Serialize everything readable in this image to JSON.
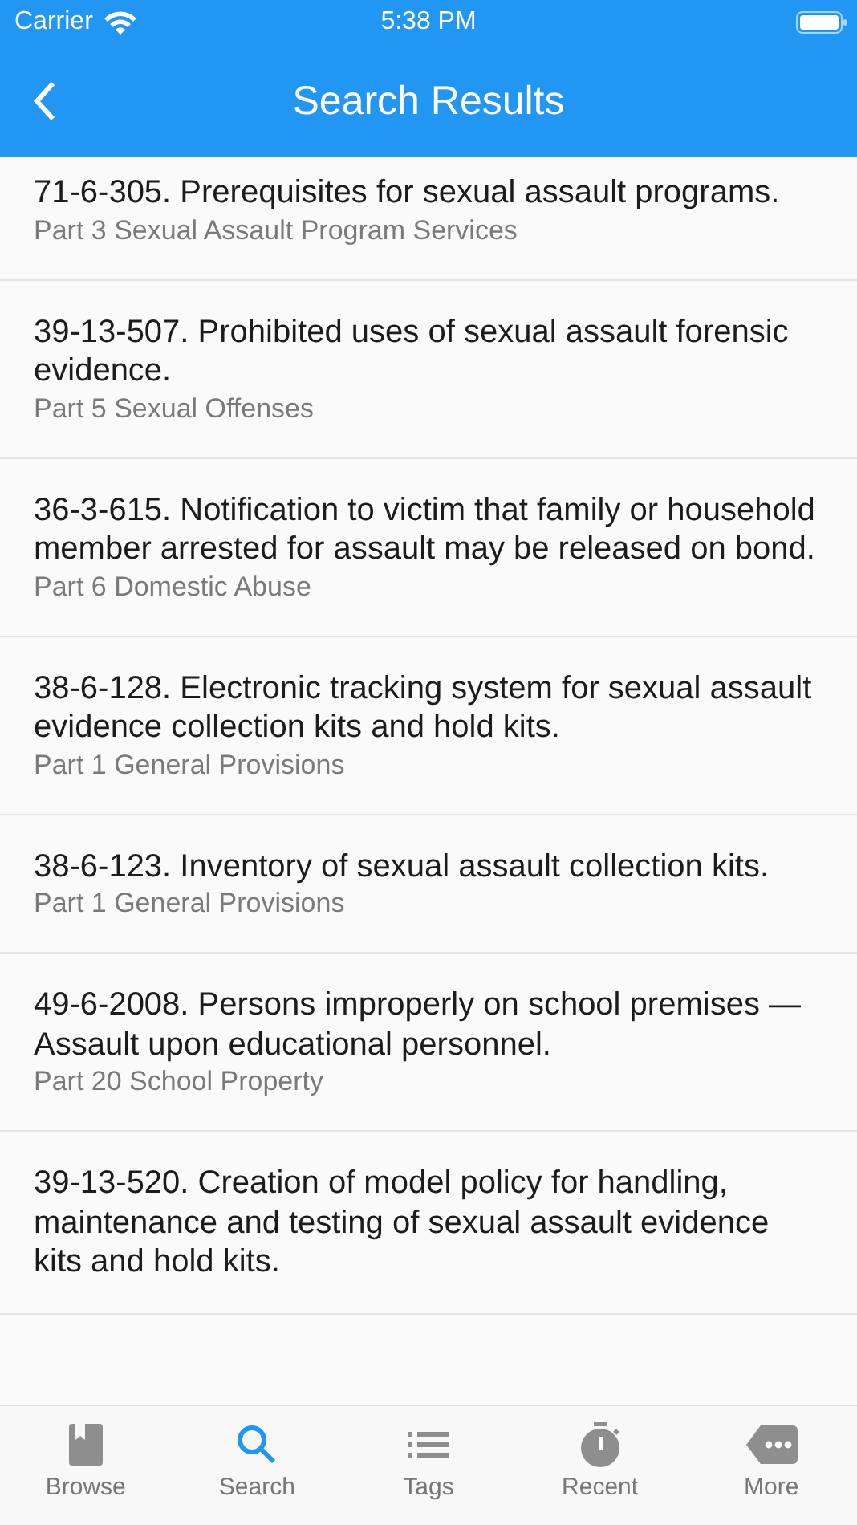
{
  "status_bar": {
    "carrier": "Carrier",
    "time": "5:38 PM"
  },
  "nav_bar": {
    "title": "Search Results"
  },
  "results": [
    {
      "title": "71-6-305. Prerequisites for sexual assault programs.",
      "subtitle": "Part 3 Sexual Assault Program Services"
    },
    {
      "title": "39-13-507. Prohibited uses of sexual assault forensic evidence.",
      "subtitle": "Part 5 Sexual Offenses"
    },
    {
      "title": "36-3-615. Notification to victim that family or household member arrested for assault may be released on bond.",
      "subtitle": "Part 6 Domestic Abuse"
    },
    {
      "title": "38-6-128. Electronic tracking system for sexual assault evidence collection kits and hold kits.",
      "subtitle": "Part 1 General Provisions"
    },
    {
      "title": "38-6-123. Inventory of sexual assault collection kits.",
      "subtitle": "Part 1 General Provisions"
    },
    {
      "title": "49-6-2008. Persons improperly on school premises — Assault upon educational personnel.",
      "subtitle": "Part 20 School Property"
    },
    {
      "title": "39-13-520. Creation of model policy for handling, maintenance and testing of sexual assault evidence kits and hold kits."
    }
  ],
  "tab_bar": [
    {
      "kind": "book",
      "label": "Browse",
      "selected": false
    },
    {
      "kind": "search",
      "label": "Search",
      "selected": true
    },
    {
      "kind": "list",
      "label": "Tags",
      "selected": false
    },
    {
      "kind": "timer",
      "label": "Recent",
      "selected": false
    },
    {
      "kind": "more",
      "label": "More",
      "selected": false
    }
  ]
}
